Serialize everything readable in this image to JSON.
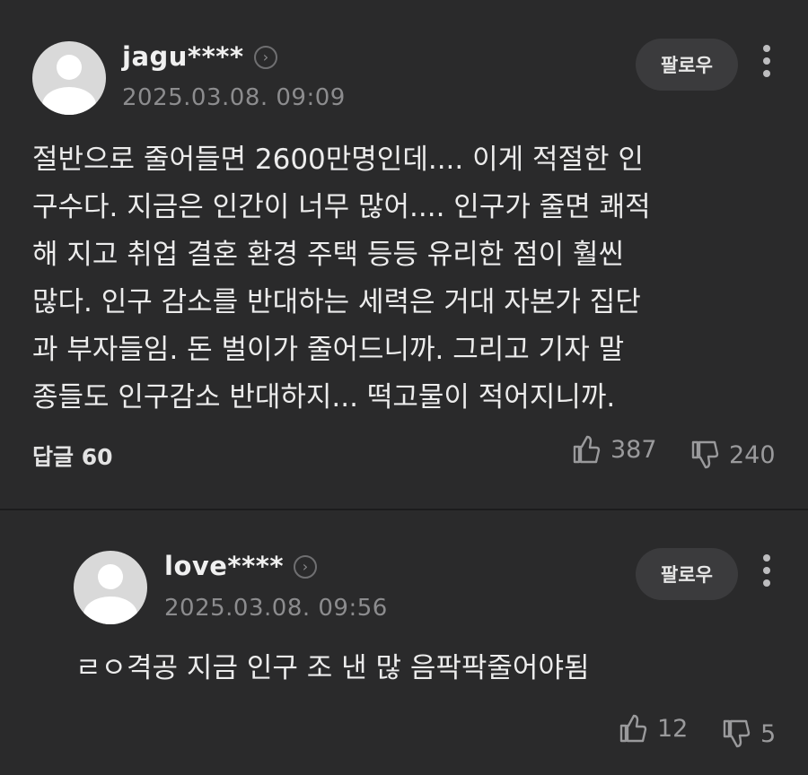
{
  "comments": [
    {
      "username": "jagu****",
      "date": "2025.03.08. 09:09",
      "follow_label": "팔로우",
      "text": "절반으로 줄어들면 2600만명인데.... 이게 적절한 인\n구수다. 지금은 인간이 너무 많어.... 인구가 줄면 쾌적\n해 지고 취업 결혼 환경 주택 등등 유리한 점이 훨씬\n많다. 인구 감소를 반대하는 세력은 거대 자본가 집단\n과 부자들임. 돈 벌이가 줄어드니까. 그리고 기자 말\n종들도 인구감소 반대하지... 떡고물이 적어지니까.",
      "reply_label": "답글 60",
      "likes": "387",
      "dislikes": "240"
    },
    {
      "username": "love****",
      "date": "2025.03.08. 09:56",
      "follow_label": "팔로우",
      "text": "ㄹㅇ격공 지금 인구 조 낸 많 음팍팍줄어야됨",
      "likes": "12",
      "dislikes": "5"
    }
  ],
  "icons": {
    "avatar": "default-profile-icon",
    "chevron": "chevron-right-icon",
    "more": "more-vertical-icon",
    "like": "thumbs-up-icon",
    "dislike": "thumbs-down-icon"
  },
  "colors": {
    "background": "#2a2a2b",
    "separator": "#1c1c1d",
    "button": "#3b3b3d",
    "muted_text": "#8c8c8e"
  }
}
